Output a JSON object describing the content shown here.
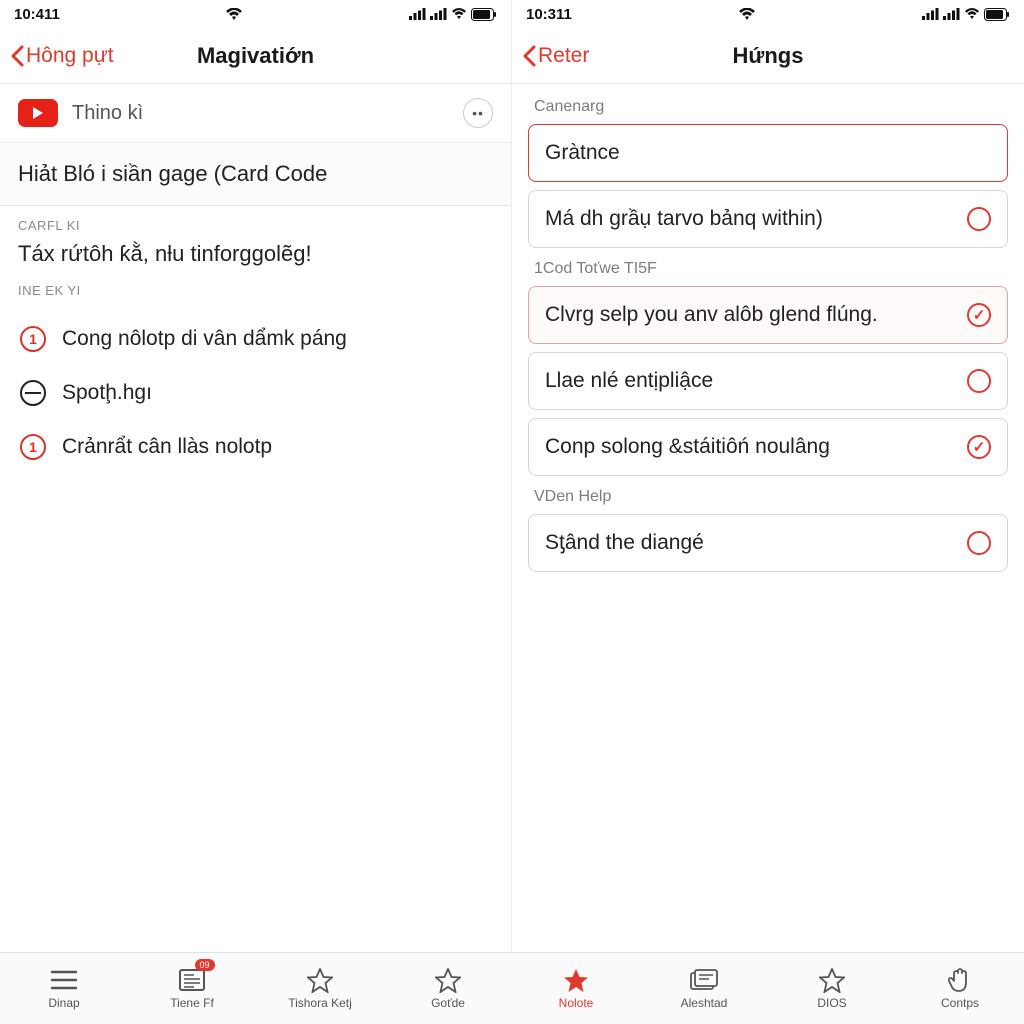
{
  "left": {
    "status_time": "10:411",
    "back_label": "Hông pựt",
    "title": "Magivatiớn",
    "video_title": "Thino kì",
    "big_item": "Hiảt Bló i siần gage (Card Code",
    "section1": "CARFL KI",
    "headline": "Táx rứtôh ƙằ, nƚu tinforggolẽg!",
    "section2": "INE EK YI",
    "rows": [
      {
        "num": "1",
        "text": "Cong nôlotp di vân dẩmk páng"
      },
      {
        "num": "",
        "text": "Spotḩ.hgı"
      },
      {
        "num": "1",
        "text": "Crảnrẩt cân llàs nolotp"
      }
    ]
  },
  "right": {
    "status_time": "10:311",
    "back_label": "Reter",
    "title": "Hứngs",
    "label1": "Canenarg",
    "item1": "Gràtnce",
    "item2": "Má dh grầụ tarvo bảnq within)",
    "label2": "1Cod Toťwe TI5F",
    "item3": "Clvrg selp you anv alôb glend flúng.",
    "item4": "Llae nlé entịpliậce",
    "item5": "Conp solong &stáitiôń noulâng",
    "label3": "VDen Help",
    "item6": "Sƫând the diangé"
  },
  "tabs": [
    {
      "label": "Dinap"
    },
    {
      "label": "Tiene Ff",
      "badge": "09"
    },
    {
      "label": "Tishora Ketj"
    },
    {
      "label": "Goťde"
    },
    {
      "label": "Nolote"
    },
    {
      "label": "Aleshtad"
    },
    {
      "label": "DIOS"
    },
    {
      "label": "Contps"
    }
  ]
}
